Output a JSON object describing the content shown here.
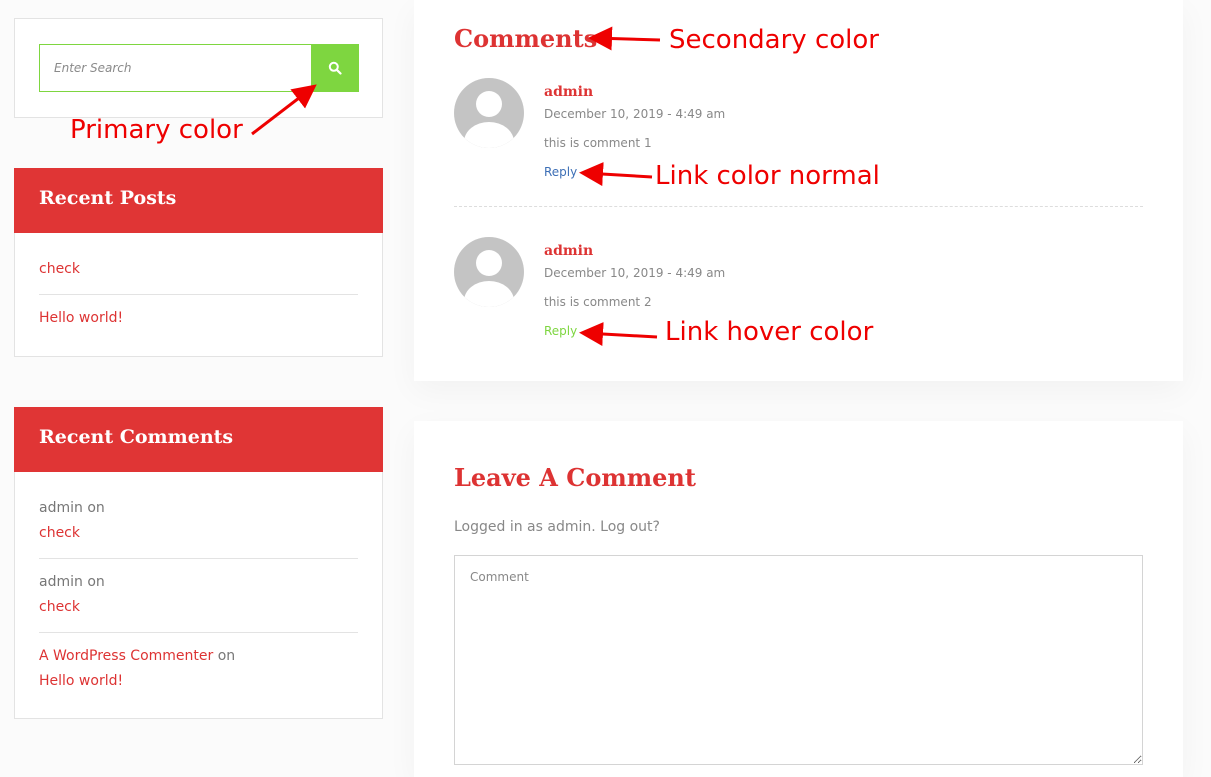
{
  "colors": {
    "primary": "#7ed640",
    "secondary": "#dd3333",
    "link_normal": "#3d6fb6",
    "link_hover": "#7ed640",
    "annotation": "#ee0000"
  },
  "search": {
    "placeholder": "Enter Search",
    "icon": "search-icon"
  },
  "recent_posts": {
    "title": "Recent Posts",
    "items": [
      {
        "label": "check"
      },
      {
        "label": "Hello world!"
      }
    ]
  },
  "recent_comments": {
    "title": "Recent Comments",
    "items": [
      {
        "author": "admin",
        "on": "on",
        "post": "check"
      },
      {
        "author": "admin",
        "on": "on",
        "post": "check"
      },
      {
        "author": "A WordPress Commenter",
        "on": "on",
        "post": "Hello world!"
      }
    ]
  },
  "comments": {
    "title": "Comments",
    "items": [
      {
        "author": "admin",
        "date": "December 10, 2019 - 4:49 am",
        "text": "this is comment 1",
        "reply": "Reply"
      },
      {
        "author": "admin",
        "date": "December 10, 2019 - 4:49 am",
        "text": "this is comment 2",
        "reply": "Reply"
      }
    ]
  },
  "leave_comment": {
    "title": "Leave A Comment",
    "logged_in_text": "Logged in as admin. Log out?",
    "textarea_placeholder": "Comment"
  },
  "annotations": {
    "primary_color": "Primary color",
    "secondary_color": "Secondary color",
    "link_color_normal": "Link color normal",
    "link_hover_color": "Link hover color"
  }
}
